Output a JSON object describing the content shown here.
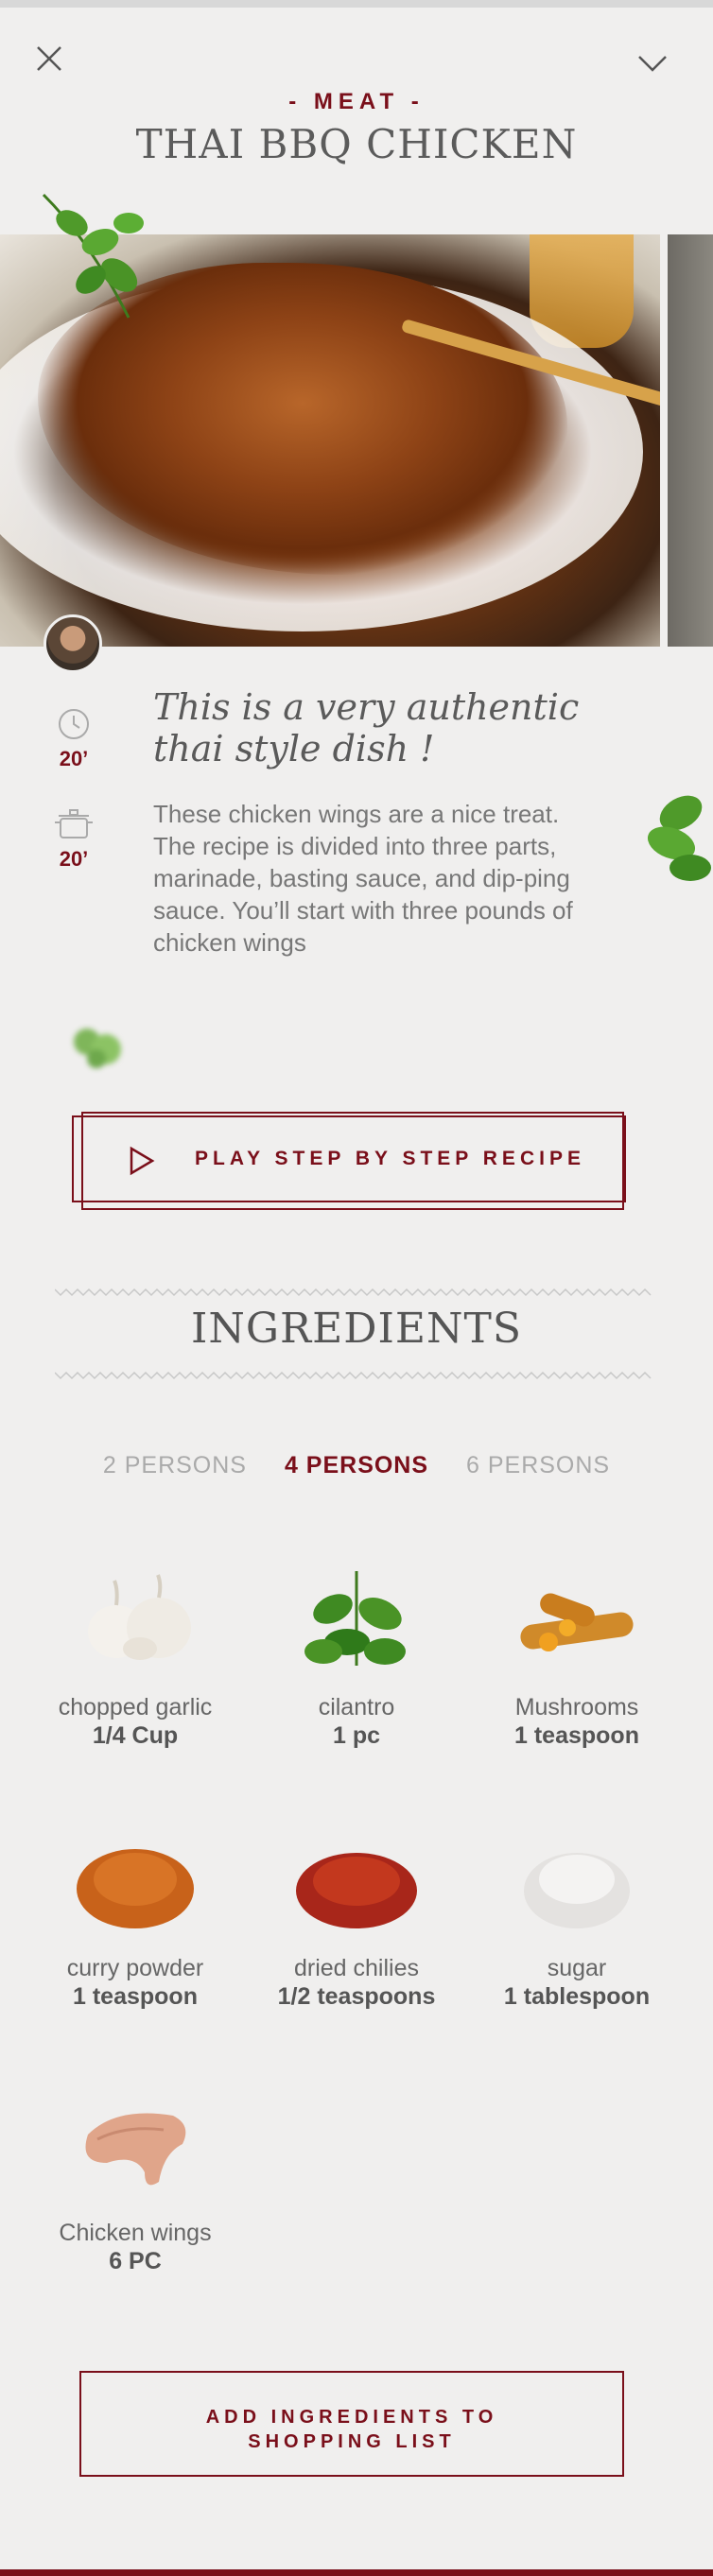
{
  "header": {
    "category": "- MEAT -",
    "title": "THAI BBQ CHICKEN"
  },
  "stats": {
    "time": "20’",
    "cook": "20’"
  },
  "intro": {
    "headline": "This is a very authentic thai style dish !",
    "description": "These chicken wings are a nice treat. The recipe is divided into three parts, marinade, basting sauce, and dip-ping sauce. You’ll start with three pounds of chicken wings"
  },
  "play_button": {
    "label": "PLAY STEP BY STEP RECIPE"
  },
  "ingredients": {
    "title": "INGREDIENTS",
    "persons": [
      "2 PERSONS",
      "4 PERSONS",
      "6 PERSONS"
    ],
    "selected_persons": "4 PERSONS",
    "items": [
      {
        "name": "chopped garlic",
        "qty": "1/4 Cup"
      },
      {
        "name": "cilantro",
        "qty": "1 pc"
      },
      {
        "name": "Mushrooms",
        "qty": "1 teaspoon"
      },
      {
        "name": "curry powder",
        "qty": "1 teaspoon"
      },
      {
        "name": "dried chilies",
        "qty": "1/2  teaspoons"
      },
      {
        "name": "sugar",
        "qty": "1 tablespoon"
      },
      {
        "name": "Chicken wings",
        "qty": "6 PC"
      }
    ]
  },
  "shop_button": {
    "line1": "ADD INGREDIENTS TO",
    "line2": "SHOPPING LIST"
  },
  "colors": {
    "accent": "#7a0f1a",
    "background": "#f0efee"
  },
  "icons": [
    "close-icon",
    "chevron-down-icon",
    "clock-icon",
    "pot-icon",
    "play-icon"
  ]
}
